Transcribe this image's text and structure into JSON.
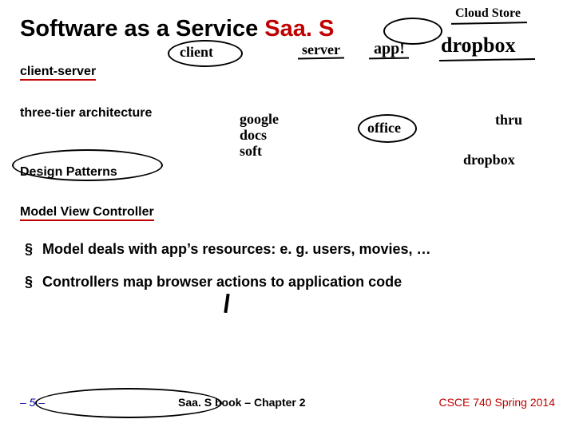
{
  "title": {
    "main": "Software as a Service ",
    "abbr": "Saa. S"
  },
  "subheads": {
    "client_server": "client-server",
    "three_tier": "three-tier architecture",
    "design_patterns": "Design Patterns",
    "mvc": "Model View Controller"
  },
  "bullets": {
    "b1": "Model deals with app’s resources: e. g. users, movies, …",
    "b2": "Controllers map browser actions to application code"
  },
  "footer": {
    "page": "– 5 –",
    "book": "Saa. S book – Chapter 2",
    "course": "CSCE 740 Spring 2014"
  },
  "handwriting": {
    "client": "client",
    "server": "server",
    "app": "app!",
    "cloud_store": "Cloud Store",
    "dropbox": "dropbox",
    "google_docs": "google\ndocs\nsoft",
    "office": "office",
    "thru": "thru",
    "dropbox2": "dropbox"
  }
}
